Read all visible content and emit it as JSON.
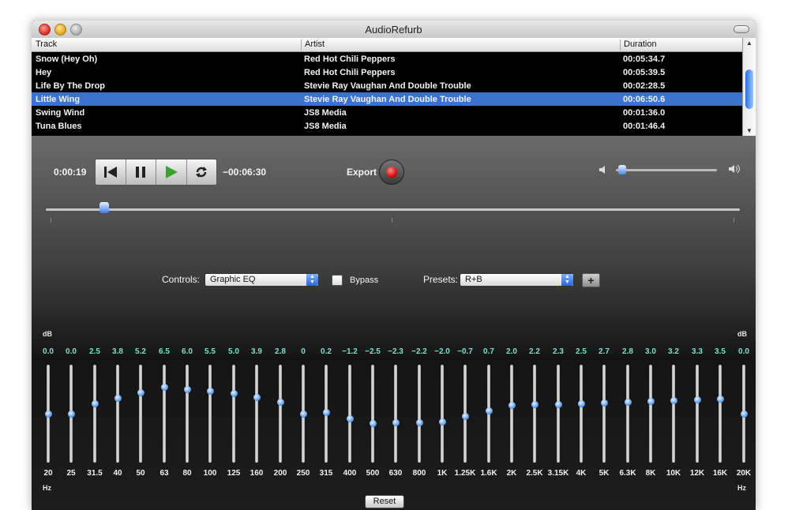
{
  "window": {
    "title": "AudioRefurb"
  },
  "table": {
    "columns": [
      "Track",
      "Artist",
      "Duration"
    ],
    "rows": [
      {
        "track": "Snow (Hey Oh)",
        "artist": "Red Hot Chili Peppers",
        "duration": "00:05:34.7",
        "selected": false
      },
      {
        "track": "Hey",
        "artist": "Red Hot Chili Peppers",
        "duration": "00:05:39.5",
        "selected": false
      },
      {
        "track": "Life By The Drop",
        "artist": "Stevie Ray Vaughan And Double Trouble",
        "duration": "00:02:28.5",
        "selected": false
      },
      {
        "track": "Little Wing",
        "artist": "Stevie Ray Vaughan And Double Trouble",
        "duration": "00:06:50.6",
        "selected": true
      },
      {
        "track": "Swing Wind",
        "artist": "JS8 Media",
        "duration": "00:01:36.0",
        "selected": false
      },
      {
        "track": "Tuna Blues",
        "artist": "JS8 Media",
        "duration": "00:01:46.4",
        "selected": false
      }
    ]
  },
  "transport": {
    "elapsed": "0:00:19",
    "remaining": "−00:06:30",
    "export_label": "Export",
    "volume_level": 0.12,
    "position_fraction": 0.05,
    "icons": [
      "skip-back-icon",
      "pause-icon",
      "play-icon",
      "repeat-icon"
    ]
  },
  "controls": {
    "controls_label": "Controls:",
    "controls_value": "Graphic EQ",
    "bypass_label": "Bypass",
    "presets_label": "Presets:",
    "presets_value": "R+B"
  },
  "eq": {
    "db_label": "dB",
    "hz_label": "Hz",
    "reset_label": "Reset",
    "range_db": [
      -12,
      12
    ],
    "bands": [
      {
        "freq": "20",
        "gain_label": "0.0",
        "gain": 0.0
      },
      {
        "freq": "25",
        "gain_label": "0.0",
        "gain": 0.0
      },
      {
        "freq": "31.5",
        "gain_label": "2.5",
        "gain": 2.5
      },
      {
        "freq": "40",
        "gain_label": "3.8",
        "gain": 3.8
      },
      {
        "freq": "50",
        "gain_label": "5.2",
        "gain": 5.2
      },
      {
        "freq": "63",
        "gain_label": "6.5",
        "gain": 6.5
      },
      {
        "freq": "80",
        "gain_label": "6.0",
        "gain": 6.0
      },
      {
        "freq": "100",
        "gain_label": "5.5",
        "gain": 5.5
      },
      {
        "freq": "125",
        "gain_label": "5.0",
        "gain": 5.0
      },
      {
        "freq": "160",
        "gain_label": "3.9",
        "gain": 3.9
      },
      {
        "freq": "200",
        "gain_label": "2.8",
        "gain": 2.8
      },
      {
        "freq": "250",
        "gain_label": "0",
        "gain": 0
      },
      {
        "freq": "315",
        "gain_label": "0.2",
        "gain": 0.2
      },
      {
        "freq": "400",
        "gain_label": "−1.2",
        "gain": -1.2
      },
      {
        "freq": "500",
        "gain_label": "−2.5",
        "gain": -2.5
      },
      {
        "freq": "630",
        "gain_label": "−2.3",
        "gain": -2.3
      },
      {
        "freq": "800",
        "gain_label": "−2.2",
        "gain": -2.2
      },
      {
        "freq": "1K",
        "gain_label": "−2.0",
        "gain": -2.0
      },
      {
        "freq": "1.25K",
        "gain_label": "−0.7",
        "gain": -0.7
      },
      {
        "freq": "1.6K",
        "gain_label": "0.7",
        "gain": 0.7
      },
      {
        "freq": "2K",
        "gain_label": "2.0",
        "gain": 2.0
      },
      {
        "freq": "2.5K",
        "gain_label": "2.2",
        "gain": 2.2
      },
      {
        "freq": "3.15K",
        "gain_label": "2.3",
        "gain": 2.3
      },
      {
        "freq": "4K",
        "gain_label": "2.5",
        "gain": 2.5
      },
      {
        "freq": "5K",
        "gain_label": "2.7",
        "gain": 2.7
      },
      {
        "freq": "6.3K",
        "gain_label": "2.8",
        "gain": 2.8
      },
      {
        "freq": "8K",
        "gain_label": "3.0",
        "gain": 3.0
      },
      {
        "freq": "10K",
        "gain_label": "3.2",
        "gain": 3.2
      },
      {
        "freq": "12K",
        "gain_label": "3.3",
        "gain": 3.3
      },
      {
        "freq": "16K",
        "gain_label": "3.5",
        "gain": 3.5
      },
      {
        "freq": "20K",
        "gain_label": "0.0",
        "gain": 0.0
      }
    ]
  }
}
